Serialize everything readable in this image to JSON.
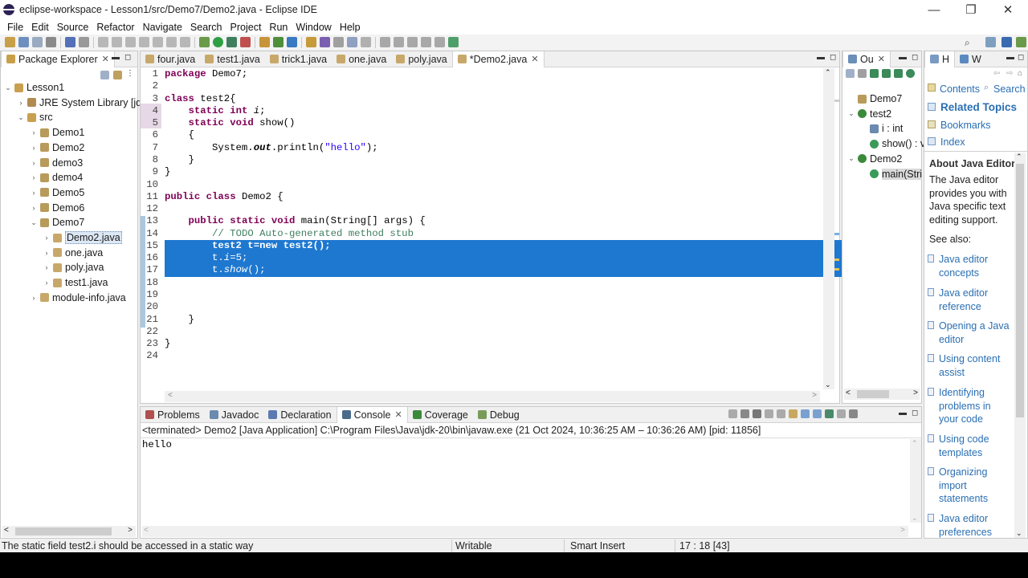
{
  "window": {
    "title": "eclipse-workspace - Lesson1/src/Demo7/Demo2.java - Eclipse IDE",
    "minimize": "—",
    "restore": "❐",
    "close": "✕"
  },
  "menu": [
    "File",
    "Edit",
    "Source",
    "Refactor",
    "Navigate",
    "Search",
    "Project",
    "Run",
    "Window",
    "Help"
  ],
  "package_explorer": {
    "tab_label": "Package Explorer",
    "tree": [
      {
        "label": "Lesson1",
        "depth": 0,
        "expanded": true,
        "icon": "project-icon"
      },
      {
        "label": "JRE System Library [jdk",
        "depth": 1,
        "expanded": false,
        "icon": "library-icon"
      },
      {
        "label": "src",
        "depth": 1,
        "expanded": true,
        "icon": "source-folder-icon"
      },
      {
        "label": "Demo1",
        "depth": 2,
        "expanded": false,
        "icon": "package-icon"
      },
      {
        "label": "Demo2",
        "depth": 2,
        "expanded": false,
        "icon": "package-icon"
      },
      {
        "label": "demo3",
        "depth": 2,
        "expanded": false,
        "icon": "package-icon"
      },
      {
        "label": "demo4",
        "depth": 2,
        "expanded": false,
        "icon": "package-icon"
      },
      {
        "label": "Demo5",
        "depth": 2,
        "expanded": false,
        "icon": "package-icon"
      },
      {
        "label": "Demo6",
        "depth": 2,
        "expanded": false,
        "icon": "package-icon"
      },
      {
        "label": "Demo7",
        "depth": 2,
        "expanded": true,
        "icon": "package-icon"
      },
      {
        "label": "Demo2.java",
        "depth": 3,
        "expanded": false,
        "icon": "java-file-icon",
        "selected": true
      },
      {
        "label": "one.java",
        "depth": 3,
        "expanded": false,
        "icon": "java-file-icon"
      },
      {
        "label": "poly.java",
        "depth": 3,
        "expanded": false,
        "icon": "java-file-icon"
      },
      {
        "label": "test1.java",
        "depth": 3,
        "expanded": false,
        "icon": "java-file-icon"
      },
      {
        "label": "module-info.java",
        "depth": 2,
        "expanded": false,
        "icon": "java-file-icon"
      }
    ]
  },
  "editor": {
    "tabs": [
      "four.java",
      "test1.java",
      "trick1.java",
      "one.java",
      "poly.java",
      "*Demo2.java"
    ],
    "active_tab": 5,
    "lines": [
      {
        "n": "1",
        "html": "<span class=\"kw\">package</span> Demo7;"
      },
      {
        "n": "2",
        "html": ""
      },
      {
        "n": "3",
        "html": "<span class=\"kw\">class</span> test2{"
      },
      {
        "n": "4",
        "html": "    <span class=\"kw\">static</span> <span class=\"kw\">int</span> <span class=\"it\">i</span>;"
      },
      {
        "n": "5",
        "html": "    <span class=\"kw\">static</span> <span class=\"kw\">void</span> show()"
      },
      {
        "n": "6",
        "html": "    {"
      },
      {
        "n": "7",
        "html": "        System.<span class=\"it\" style=\"font-weight:bold\">out</span>.println(<span class=\"st\">\"hello\"</span>);"
      },
      {
        "n": "8",
        "html": "    }"
      },
      {
        "n": "9",
        "html": "}"
      },
      {
        "n": "10",
        "html": ""
      },
      {
        "n": "11",
        "html": "<span class=\"kw\">public</span> <span class=\"kw\">class</span> Demo2 {"
      },
      {
        "n": "12",
        "html": ""
      },
      {
        "n": "13",
        "html": "    <span class=\"kw\">public</span> <span class=\"kw\">static</span> <span class=\"kw\">void</span> main(String[] args) {"
      },
      {
        "n": "14",
        "html": "        <span class=\"cm\">// TODO Auto-generated method stub</span>"
      },
      {
        "n": "15",
        "html": "<span style=\"color:#fff;font-weight:bold\">        test2 t=new test2();</span>"
      },
      {
        "n": "16",
        "html": "<span style=\"color:#fff\">        t.<span class=\"it\">i</span>=5;</span>"
      },
      {
        "n": "17",
        "html": "<span style=\"color:#fff\">        t.<span class=\"it\">show</span>();</span>"
      },
      {
        "n": "18",
        "html": ""
      },
      {
        "n": "19",
        "html": ""
      },
      {
        "n": "20",
        "html": ""
      },
      {
        "n": "21",
        "html": "    }"
      },
      {
        "n": "22",
        "html": ""
      },
      {
        "n": "23",
        "html": "}"
      },
      {
        "n": "24",
        "html": ""
      }
    ]
  },
  "outline": {
    "tab_label": "Ou",
    "items": [
      {
        "label": "Demo7",
        "depth": 0,
        "icon": "package-icon"
      },
      {
        "label": "test2",
        "depth": 0,
        "icon": "class-icon",
        "expanded": true
      },
      {
        "label": "i : int",
        "depth": 1,
        "icon": "field-icon"
      },
      {
        "label": "show() : v",
        "depth": 1,
        "icon": "method-icon"
      },
      {
        "label": "Demo2",
        "depth": 0,
        "icon": "class-icon",
        "expanded": true
      },
      {
        "label": "main(Stri",
        "depth": 1,
        "icon": "method-icon",
        "selected": true
      }
    ]
  },
  "help": {
    "tabs": [
      "H",
      "W"
    ],
    "nav": [
      "Contents",
      "Search"
    ],
    "related_topics": "Related Topics",
    "bookmarks": "Bookmarks",
    "index": "Index",
    "about_title": "About Java Editor",
    "about_text": "The Java editor provides you with Java specific text editing support.",
    "see_also": "See also:",
    "links": [
      "Java editor concepts",
      "Java editor reference",
      "Opening a Java editor",
      "Using content assist",
      "Identifying problems in your code",
      "Using code templates",
      "Organizing import statements",
      "Java editor preferences"
    ]
  },
  "bottom": {
    "tabs": [
      "Problems",
      "Javadoc",
      "Declaration",
      "Console",
      "Coverage",
      "Debug"
    ],
    "active_tab": 3,
    "terminated": "<terminated> Demo2 [Java Application] C:\\Program Files\\Java\\jdk-20\\bin\\javaw.exe  (21 Oct 2024, 10:36:25 AM – 10:36:26 AM) [pid: 11856]",
    "output": "hello"
  },
  "status": {
    "message": "The static field test2.i should be accessed in a static way",
    "writable": "Writable",
    "insert_mode": "Smart Insert",
    "position": "17 : 18 [43]"
  },
  "colors": {
    "selection": "#1e78d0",
    "keyword": "#7f0055",
    "comment": "#3f7f5f",
    "string": "#2a00ff",
    "link": "#2a6fb3"
  }
}
